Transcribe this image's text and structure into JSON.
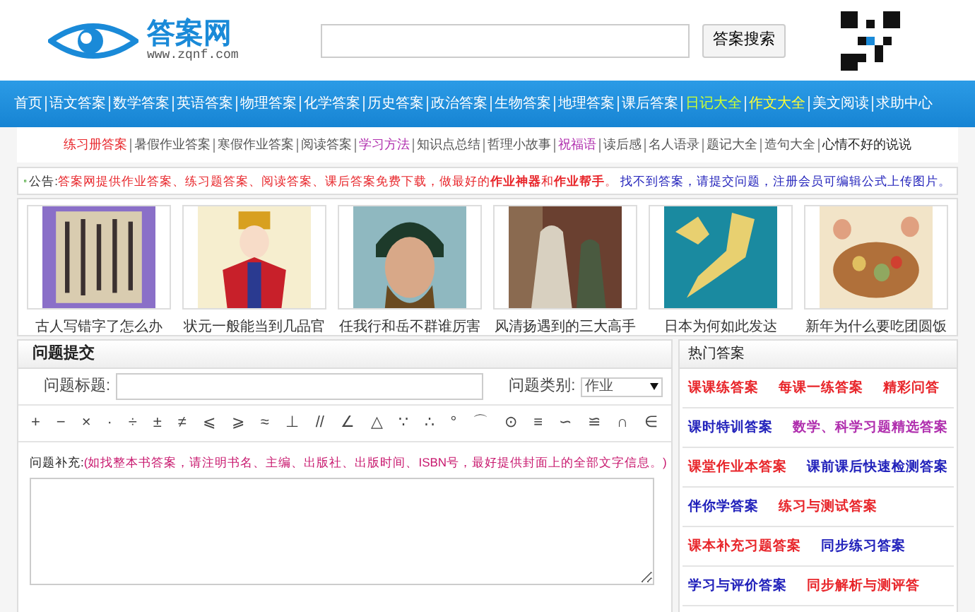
{
  "header": {
    "logo_name": "答案网",
    "logo_url": "www.zqnf.com",
    "search_button": "答案搜索"
  },
  "nav": [
    {
      "label": "首页",
      "color": "#ffffff"
    },
    {
      "label": "语文答案",
      "color": "#ffffff"
    },
    {
      "label": "数学答案",
      "color": "#ffffff"
    },
    {
      "label": "英语答案",
      "color": "#ffffff"
    },
    {
      "label": "物理答案",
      "color": "#ffffff"
    },
    {
      "label": "化学答案",
      "color": "#ffffff"
    },
    {
      "label": "历史答案",
      "color": "#ffffff"
    },
    {
      "label": "政治答案",
      "color": "#ffffff"
    },
    {
      "label": "生物答案",
      "color": "#ffffff"
    },
    {
      "label": "地理答案",
      "color": "#ffffff"
    },
    {
      "label": "课后答案",
      "color": "#ffffff"
    },
    {
      "label": "日记大全",
      "color": "#ccff33"
    },
    {
      "label": "作文大全",
      "color": "#ffff33"
    },
    {
      "label": "美文阅读",
      "color": "#ffffff"
    },
    {
      "label": "求助中心",
      "color": "#ffffff"
    }
  ],
  "subnav": [
    {
      "label": "练习册答案",
      "color": "#e8262b"
    },
    {
      "label": "暑假作业答案",
      "color": "#555555"
    },
    {
      "label": "寒假作业答案",
      "color": "#555555"
    },
    {
      "label": "阅读答案",
      "color": "#555555"
    },
    {
      "label": "学习方法",
      "color": "#b02fae"
    },
    {
      "label": "知识点总结",
      "color": "#555555"
    },
    {
      "label": "哲理小故事",
      "color": "#555555"
    },
    {
      "label": "祝福语",
      "color": "#b02fae"
    },
    {
      "label": "读后感",
      "color": "#555555"
    },
    {
      "label": "名人语录",
      "color": "#555555"
    },
    {
      "label": "题记大全",
      "color": "#555555"
    },
    {
      "label": "造句大全",
      "color": "#555555"
    },
    {
      "label": "心情不好的说说",
      "color": "#222222"
    }
  ],
  "notice": {
    "label": "公告:",
    "text": "答案网提供作业答案、练习题答案、阅读答案、课后答案免费下载，做最好的**作业神器**和**作业帮手**。",
    "link": "找不到答案，请提交问题，注册会员可编辑公式上传图片。"
  },
  "gallery": [
    {
      "caption": "古人写错字了怎么办",
      "kind": "picture"
    },
    {
      "caption": "状元一般能当到几品官",
      "kind": "picture"
    },
    {
      "caption": "任我行和岳不群谁厉害",
      "kind": "picture"
    },
    {
      "caption": "风清扬遇到的三大高手",
      "kind": "picture"
    },
    {
      "caption": "日本为何如此发达",
      "kind": "picture"
    },
    {
      "caption": "新年为什么要吃团圆饭",
      "kind": "picture"
    }
  ],
  "question_form": {
    "title": "问题提交",
    "title_label": "问题标题:",
    "category_label": "问题类别:",
    "category_value": "作业",
    "symbols": [
      "+",
      "−",
      "×",
      "·",
      "÷",
      "±",
      "≠",
      "⩽",
      "⩾",
      "≈",
      "⊥",
      "//",
      "∠",
      "△",
      "∵",
      "∴",
      "°",
      "⌒",
      "⊙",
      "≡",
      "∽",
      "≌",
      "∩",
      "∈"
    ],
    "supplement_label": "问题补充:",
    "supplement_hint": "(如找整本书答案，请注明书名、主编、出版社、出版时间、ISBN号，最好提供封面上的全部文字信息。)"
  },
  "hot_answers": {
    "title": "热门答案",
    "rows": [
      [
        {
          "label": "课课练答案",
          "color": "#e8262b"
        },
        {
          "label": "每课一练答案",
          "color": "#e8262b"
        },
        {
          "label": "精彩问答",
          "color": "#e8262b"
        }
      ],
      [
        {
          "label": "课时特训答案",
          "color": "#2222bb"
        },
        {
          "label": "数学、科学习题精选答案",
          "color": "#b02fae"
        }
      ],
      [
        {
          "label": "课堂作业本答案",
          "color": "#e8262b"
        },
        {
          "label": "课前课后快速检测答案",
          "color": "#2222bb"
        }
      ],
      [
        {
          "label": "伴你学答案",
          "color": "#2222bb"
        },
        {
          "label": "练习与测试答案",
          "color": "#e8262b"
        }
      ],
      [
        {
          "label": "课本补充习题答案",
          "color": "#e8262b"
        },
        {
          "label": "同步练习答案",
          "color": "#2222bb"
        }
      ],
      [
        {
          "label": "学习与评价答案",
          "color": "#2222bb"
        },
        {
          "label": "同步解析与测评答",
          "color": "#e8262b"
        }
      ]
    ]
  }
}
